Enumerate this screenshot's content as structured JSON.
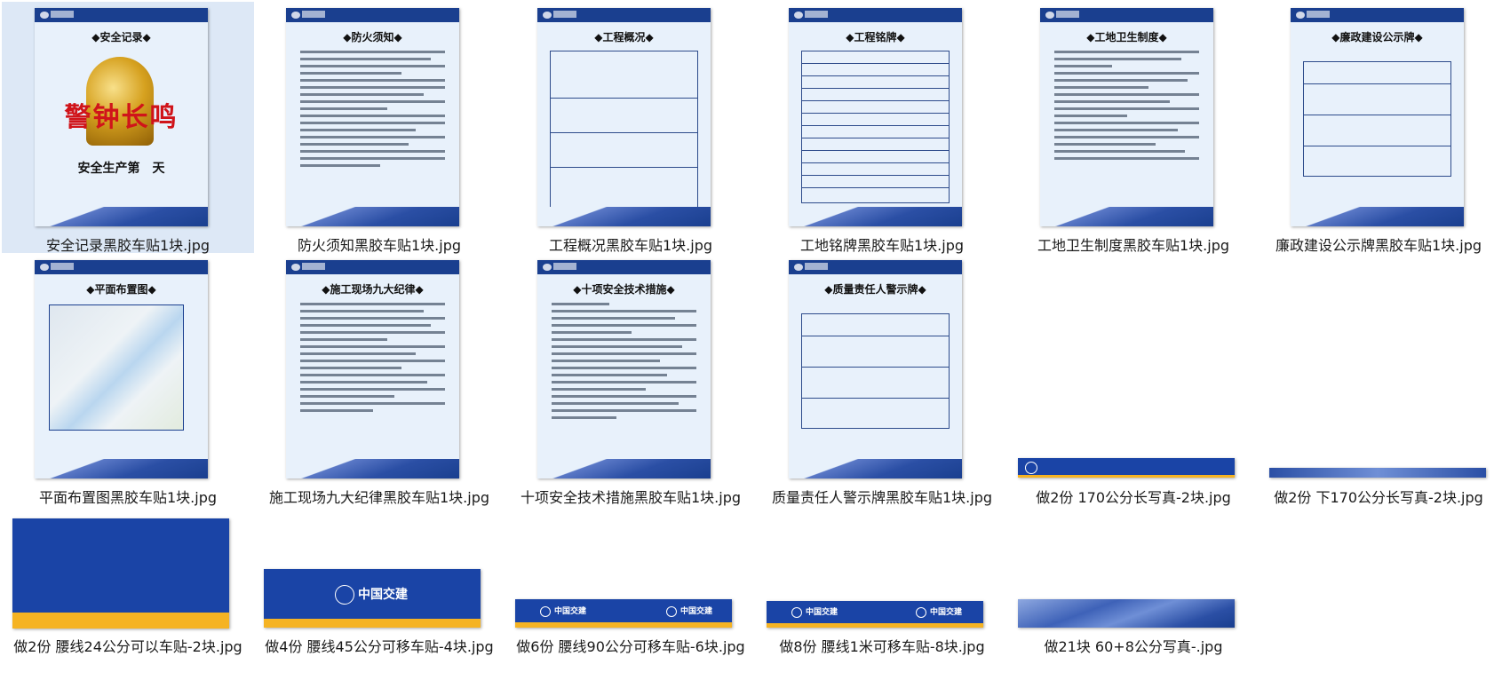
{
  "files": [
    {
      "caption": "安全记录黑胶车贴1块.jpg",
      "title": "◆安全记录◆",
      "red": "警钟长鸣",
      "black": "安全生产第　天"
    },
    {
      "caption": "防火须知黑胶车贴1块.jpg",
      "title": "◆防火须知◆"
    },
    {
      "caption": "工程概况黑胶车贴1块.jpg",
      "title": "◆工程概况◆"
    },
    {
      "caption": "工地铭牌黑胶车贴1块.jpg",
      "title": "◆工程铭牌◆"
    },
    {
      "caption": "工地卫生制度黑胶车贴1块.jpg",
      "title": "◆工地卫生制度◆"
    },
    {
      "caption": "廉政建设公示牌黑胶车贴1块.jpg",
      "title": "◆廉政建设公示牌◆"
    },
    {
      "caption": "平面布置图黑胶车贴1块.jpg",
      "title": "◆平面布置图◆"
    },
    {
      "caption": "施工现场九大纪律黑胶车贴1块.jpg",
      "title": "◆施工现场九大纪律◆"
    },
    {
      "caption": "十项安全技术措施黑胶车贴1块.jpg",
      "title": "◆十项安全技术措施◆"
    },
    {
      "caption": "质量责任人警示牌黑胶车贴1块.jpg",
      "title": "◆质量责任人警示牌◆"
    },
    {
      "caption": "做2份 170公分长写真-2块.jpg"
    },
    {
      "caption": "做2份 下170公分长写真-2块.jpg"
    },
    {
      "caption": "做2份 腰线24公分可以车贴-2块.jpg"
    },
    {
      "caption": "做4份 腰线45公分可移车贴-4块.jpg",
      "logo": "中国交建"
    },
    {
      "caption": "做6份 腰线90公分可移车贴-6块.jpg",
      "logo": "中国交建"
    },
    {
      "caption": "做8份 腰线1米可移车贴-8块.jpg",
      "logo": "中国交建"
    },
    {
      "caption": "做21块 60+8公分写真-.jpg"
    }
  ],
  "colors": {
    "navy": "#1a3f8f",
    "brandBlue": "#1a44a6",
    "yellow": "#f5b323",
    "selection": "#dde8f6"
  }
}
